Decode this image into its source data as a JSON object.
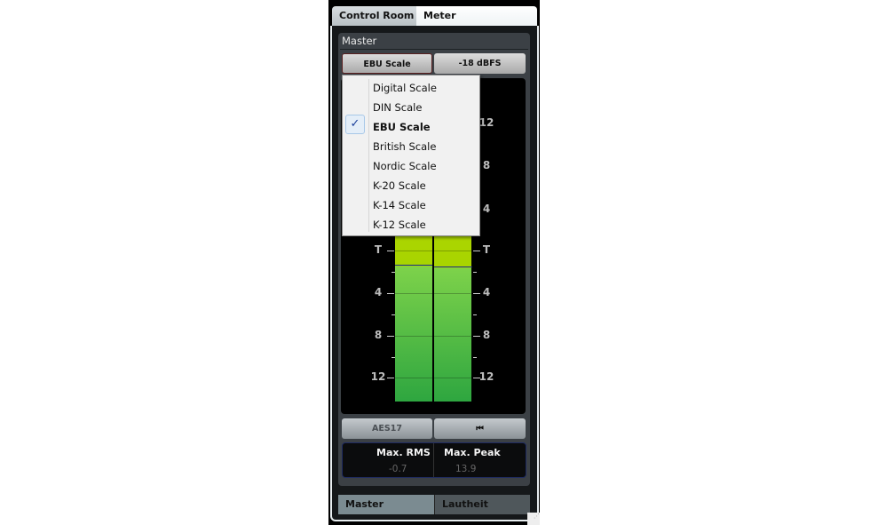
{
  "tabs": [
    {
      "label": "Control Room"
    },
    {
      "label": "Meter"
    }
  ],
  "section": {
    "title": "Master"
  },
  "scale_button": {
    "label": "EBU Scale"
  },
  "reference_button": {
    "label": "-18 dBFS"
  },
  "scale_menu": {
    "items": [
      "Digital Scale",
      "DIN Scale",
      "EBU Scale",
      "British Scale",
      "Nordic Scale",
      "K-20 Scale",
      "K-14 Scale",
      "K-12 Scale"
    ],
    "selected": "EBU Scale",
    "check": "✓"
  },
  "scale_labels": [
    "12",
    "8",
    "4",
    "T",
    "4",
    "8",
    "12"
  ],
  "meter": {
    "colors": {
      "upper": "#b8dc00",
      "lower": "#2ea640"
    }
  },
  "aes_button": {
    "label": "AES17"
  },
  "reset_button": {
    "icon": "skip-back-icon",
    "label": "⏮"
  },
  "readout": {
    "rms_label": "Max. RMS",
    "rms_value": "-0.7",
    "peak_label": "Max. Peak",
    "peak_value": "13.9"
  },
  "bottom_tabs": [
    {
      "label": "Master"
    },
    {
      "label": "Lautheit"
    }
  ]
}
